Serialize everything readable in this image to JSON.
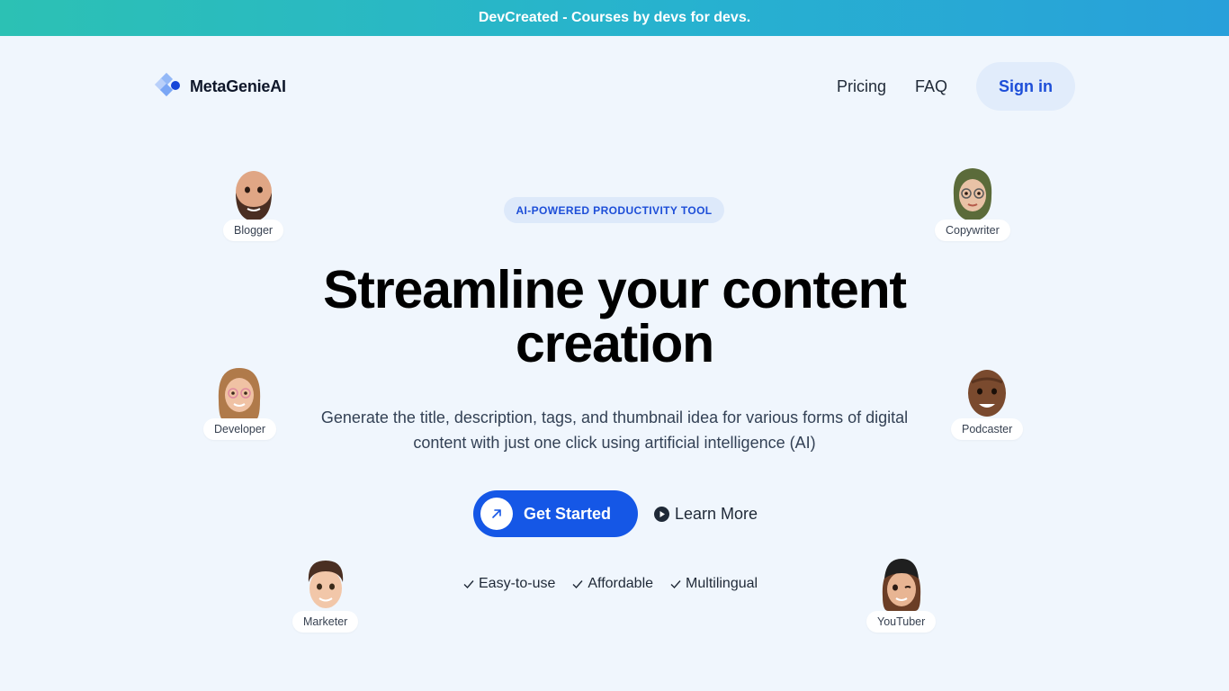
{
  "announcement": "DevCreated - Courses by devs for devs.",
  "nav": {
    "brand": "MetaGenieAI",
    "links": [
      "Pricing",
      "FAQ"
    ],
    "signin": "Sign in"
  },
  "hero": {
    "pill": "AI-POWERED PRODUCTIVITY TOOL",
    "headline_line1": "Streamline your content",
    "headline_line2": "creation",
    "subtitle_line1": "Generate the title, description, tags, and thumbnail idea for various forms of digital",
    "subtitle_line2": "content with just one click using artificial intelligence (AI)",
    "cta_primary": "Get Started",
    "cta_secondary": "Learn More",
    "features": [
      "Easy-to-use",
      "Affordable",
      "Multilingual"
    ]
  },
  "avatars": [
    "Blogger",
    "Copywriter",
    "Developer",
    "Podcaster",
    "Marketer",
    "YouTuber"
  ],
  "colors": {
    "accent": "#1557e6",
    "background": "#f0f6fd",
    "banner_start": "#2cc1b4",
    "banner_end": "#28a0da"
  }
}
